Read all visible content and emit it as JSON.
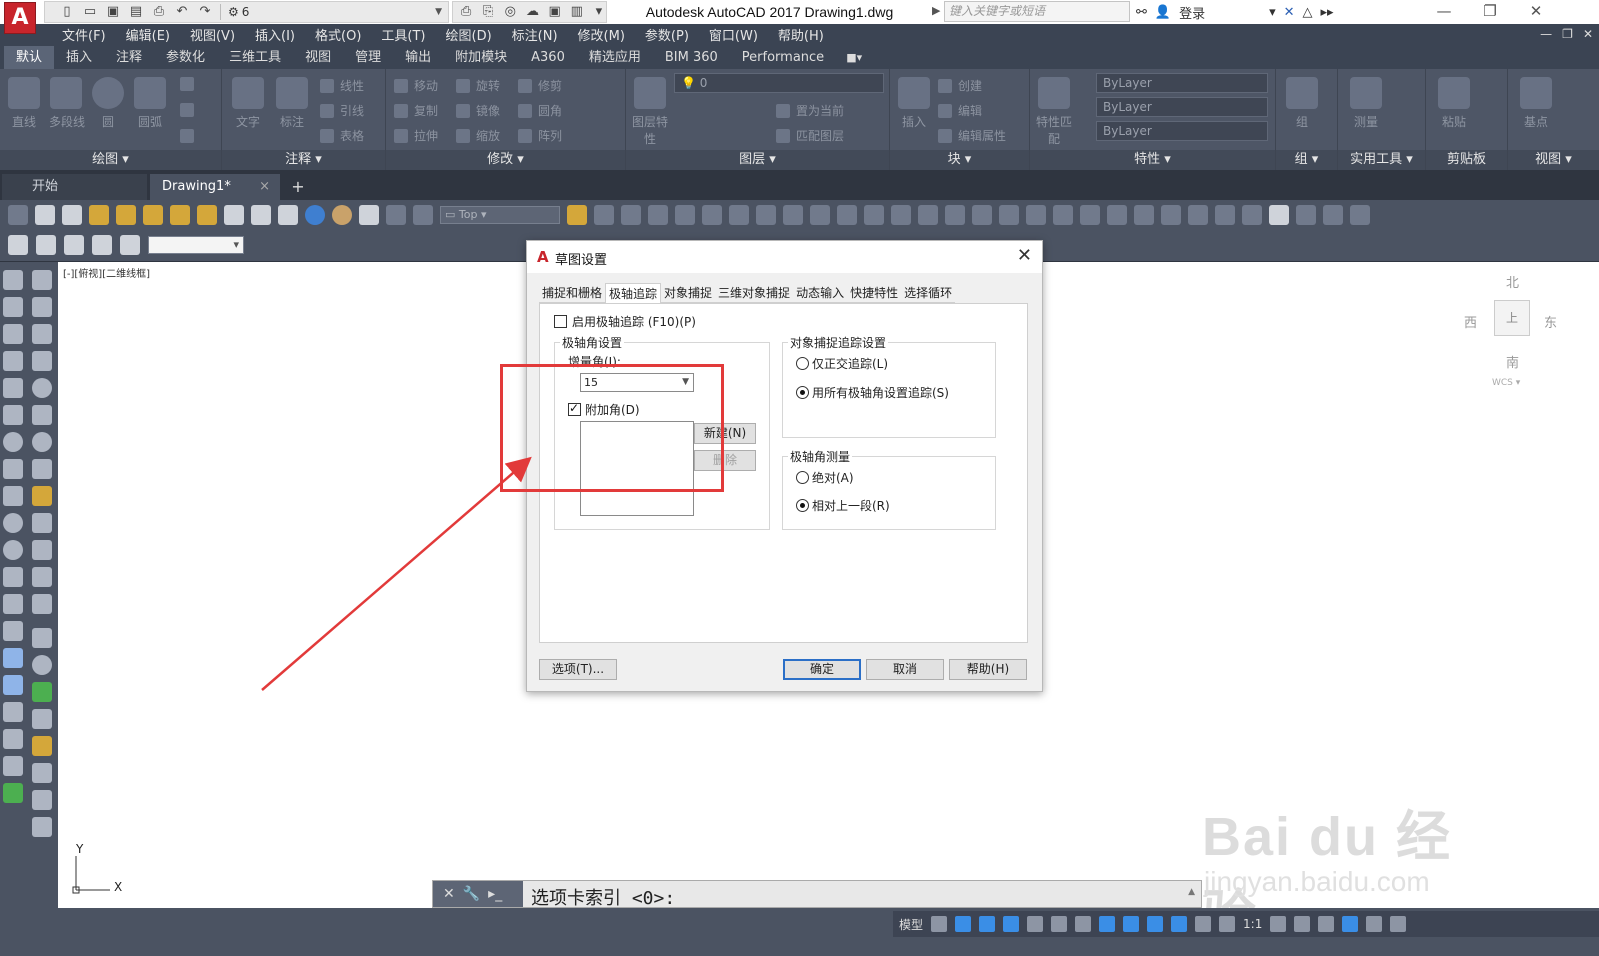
{
  "app": {
    "logo_letter": "A",
    "workspace_value": "6",
    "window_title": "Autodesk AutoCAD 2017    Drawing1.dwg",
    "search_placeholder": "键入关键字或短语",
    "login_label": "登录"
  },
  "menu": [
    "文件(F)",
    "编辑(E)",
    "视图(V)",
    "插入(I)",
    "格式(O)",
    "工具(T)",
    "绘图(D)",
    "标注(N)",
    "修改(M)",
    "参数(P)",
    "窗口(W)",
    "帮助(H)"
  ],
  "ribbon_tabs": [
    "默认",
    "插入",
    "注释",
    "参数化",
    "三维工具",
    "视图",
    "管理",
    "输出",
    "附加模块",
    "A360",
    "精选应用",
    "BIM 360",
    "Performance"
  ],
  "ribbon_panels": {
    "draw": {
      "title": "绘图",
      "tools": [
        "直线",
        "多段线",
        "圆",
        "圆弧"
      ]
    },
    "annotate": {
      "title": "注释",
      "tools": [
        "文字",
        "标注"
      ],
      "small": [
        "线性",
        "引线",
        "表格"
      ]
    },
    "modify": {
      "title": "修改",
      "small": [
        "移动",
        "旋转",
        "修剪",
        "复制",
        "镜像",
        "圆角",
        "拉伸",
        "缩放",
        "阵列"
      ]
    },
    "layers": {
      "title": "图层",
      "tools": [
        "图层特性"
      ],
      "layer_value": "0",
      "small": [
        "置为当前",
        "匹配图层"
      ]
    },
    "block": {
      "title": "块",
      "tools": [
        "插入"
      ],
      "small": [
        "创建",
        "编辑",
        "编辑属性"
      ]
    },
    "properties": {
      "title": "特性",
      "tools": [
        "特性匹配"
      ],
      "combos": [
        "ByLayer",
        "ByLayer",
        "ByLayer"
      ]
    },
    "groups": {
      "title": "组",
      "tools": [
        "组"
      ]
    },
    "utilities": {
      "title": "实用工具",
      "tools": [
        "测量"
      ]
    },
    "clipboard": {
      "title": "剪贴板",
      "tools": [
        "粘贴"
      ]
    },
    "view": {
      "title": "视图",
      "tools": [
        "基点"
      ]
    }
  },
  "doc_tabs": {
    "start": "开始",
    "drawing": "Drawing1*",
    "close": "×",
    "add": "+"
  },
  "toolbar": {
    "view_combo": "Top"
  },
  "canvas": {
    "viewport_label": "[-][俯视][二维线框]",
    "viewcube": {
      "north": "北",
      "west": "西",
      "east": "东",
      "south": "南",
      "top": "上",
      "wcs": "WCS"
    },
    "ucs": {
      "x": "X",
      "y": "Y"
    }
  },
  "command_line": {
    "prompt": "选项卡索引 <0>:"
  },
  "watermark": {
    "logo": "Bai du 经验",
    "url": "jingyan.baidu.com"
  },
  "status": {
    "model": "模型",
    "scale": "1:1"
  },
  "dialog": {
    "title": "草图设置",
    "close": "✕",
    "tabs": [
      "捕捉和栅格",
      "极轴追踪",
      "对象捕捉",
      "三维对象捕捉",
      "动态输入",
      "快捷特性",
      "选择循环"
    ],
    "active_tab": "极轴追踪",
    "enable_polar": {
      "label": "启用极轴追踪 (F10)(P)",
      "checked": false
    },
    "polar_angle_settings": {
      "title": "极轴角设置",
      "increment_label": "增量角(I):",
      "increment_value": "15",
      "additional_label": "附加角(D)",
      "additional_checked": true,
      "new_button": "新建(N)",
      "delete_button": "删除"
    },
    "snap_tracking": {
      "title": "对象捕捉追踪设置",
      "option1": "仅正交追踪(L)",
      "option2": "用所有极轴角设置追踪(S)",
      "selected": "option2"
    },
    "polar_measure": {
      "title": "极轴角测量",
      "option1": "绝对(A)",
      "option2": "相对上一段(R)",
      "selected": "option2"
    },
    "buttons": {
      "options": "选项(T)...",
      "ok": "确定",
      "cancel": "取消",
      "help": "帮助(H)"
    }
  },
  "colors": {
    "accent_red": "#e23a3a",
    "ribbon": "#4e5666",
    "menu": "#3b4453"
  }
}
